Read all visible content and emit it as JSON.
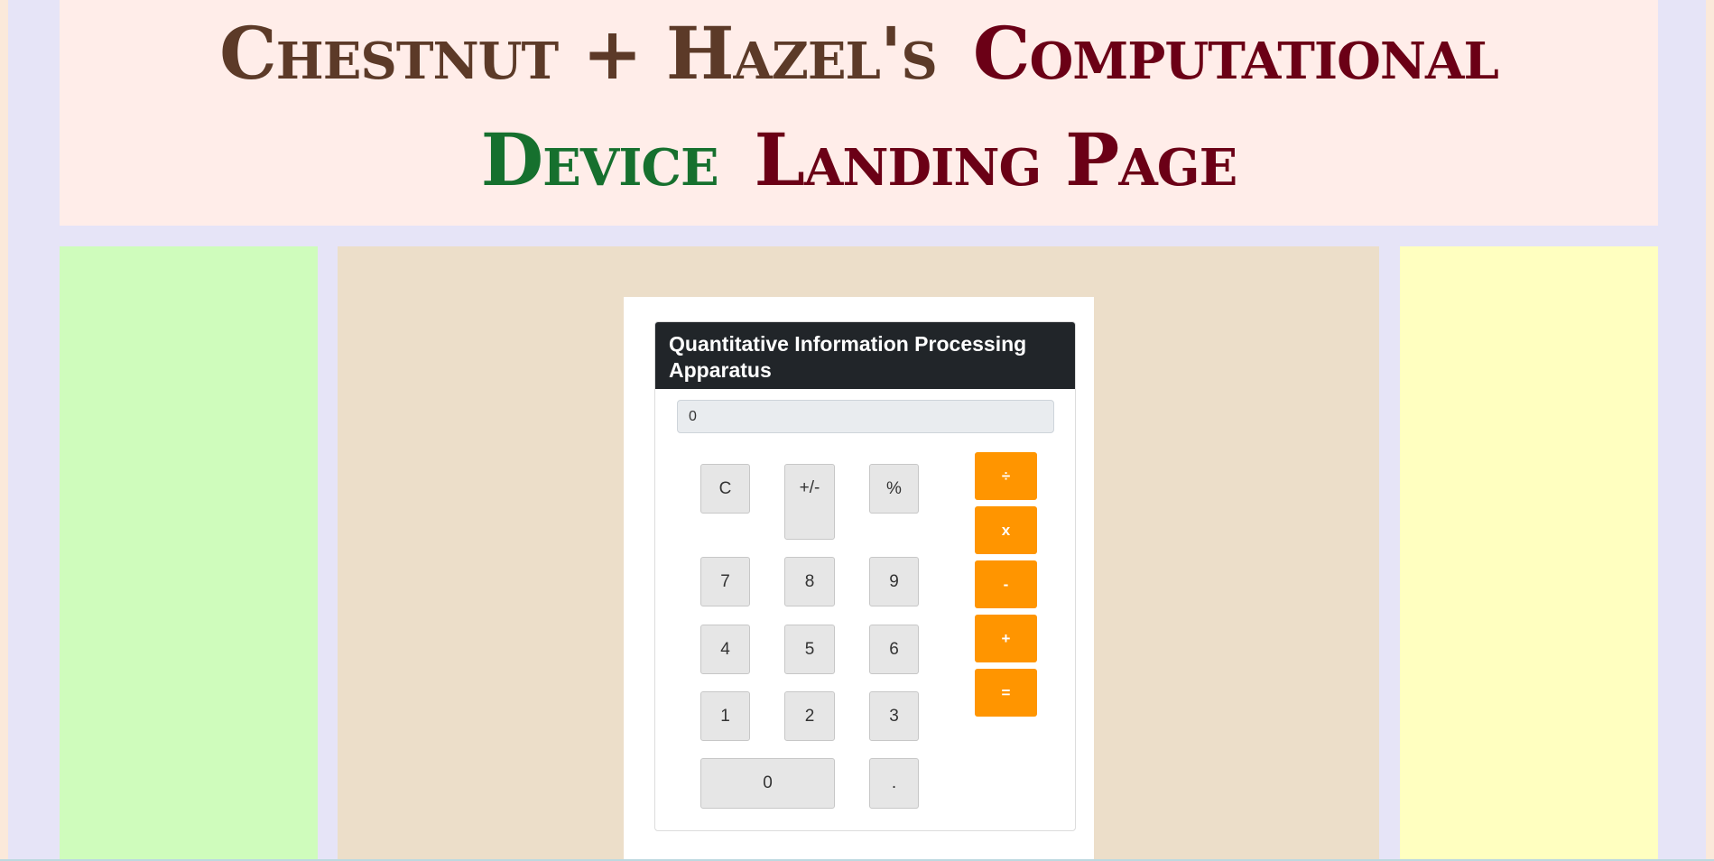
{
  "header": {
    "title_part1": "Chestnut + Hazel's",
    "title_part2": "Computational",
    "title_part3": "Device",
    "title_part4": "Landing Page",
    "colors": {
      "part1": "#5c3a28",
      "part2": "#6b0016",
      "part3": "#16702e",
      "part4": "#6b0016"
    }
  },
  "calculator": {
    "title": "Quantitative Information Processing Apparatus",
    "display_value": "0",
    "keys": {
      "clear": "C",
      "sign": "+/-",
      "percent": "%",
      "seven": "7",
      "eight": "8",
      "nine": "9",
      "four": "4",
      "five": "5",
      "six": "6",
      "one": "1",
      "two": "2",
      "three": "3",
      "zero": "0",
      "decimal": "."
    },
    "operators": {
      "divide": "÷",
      "multiply": "x",
      "subtract": "-",
      "add": "+",
      "equals": "="
    },
    "colors": {
      "header_bg": "#212529",
      "operator": "#ff9500",
      "key": "#e6e6e6"
    }
  },
  "layout_colors": {
    "left_column": "#cffcbc",
    "center_column": "#ecdec9",
    "right_column": "#ffffc0",
    "header_bg": "#ffede9"
  }
}
